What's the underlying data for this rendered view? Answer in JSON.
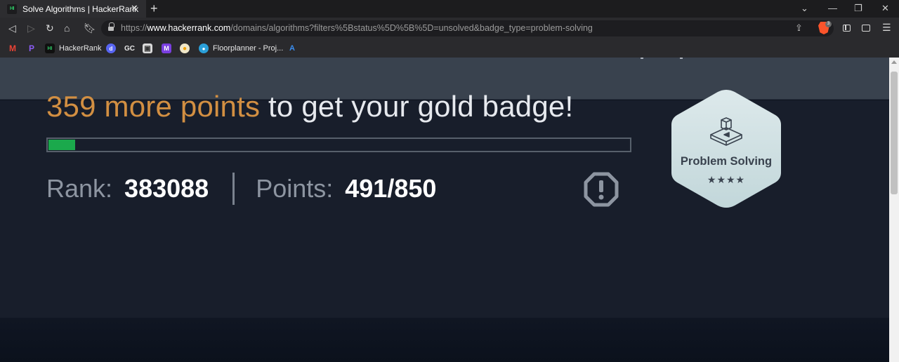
{
  "browser": {
    "tab_title": "Solve Algorithms | HackerRank",
    "favicon_text": "HI",
    "url_prefix": "https://",
    "url_host": "www.hackerrank.com",
    "url_path": "/domains/algorithms?filters%5Bstatus%5D%5B%5D=unsolved&badge_type=problem-solving",
    "shields_count": "3",
    "bookmarks": [
      {
        "name": "gmail",
        "label": "",
        "icon": "M",
        "color": "#d93025"
      },
      {
        "name": "p-app",
        "label": "",
        "icon": "P",
        "color": "#7b4bd6"
      },
      {
        "name": "hackerrank",
        "label": "HackerRank",
        "icon": "HI",
        "color": "#1c1c1e"
      },
      {
        "name": "discord",
        "label": "",
        "icon": "d",
        "color": "#5865f2"
      },
      {
        "name": "gc",
        "label": "GC",
        "icon": "",
        "color": ""
      },
      {
        "name": "image",
        "label": "",
        "icon": "▣",
        "color": "#c9c9c9"
      },
      {
        "name": "mighty",
        "label": "",
        "icon": "M",
        "color": "#7a3fe0"
      },
      {
        "name": "duck",
        "label": "",
        "icon": "●",
        "color": "#f0c000"
      },
      {
        "name": "floorplanner",
        "label": "Floorplanner - Proj...",
        "icon": "●",
        "color": "#2a9fd8"
      },
      {
        "name": "arrow",
        "label": "",
        "icon": "A",
        "color": "#2a7be0"
      }
    ]
  },
  "banner": {
    "points_needed_text": "359 more points",
    "headline_rest": " to get your gold badge!",
    "progress_fraction": 0.046,
    "rank_label": "Rank:",
    "rank_value": "383088",
    "points_label": "Points:",
    "points_value": "491/850",
    "badge_name": "Problem Solving",
    "badge_stars": "★★★★",
    "colors": {
      "accent": "#d28f42",
      "progress": "#1ba94c",
      "banner_bg": "#181e2b",
      "badge_bg": "#cde0e2"
    }
  }
}
